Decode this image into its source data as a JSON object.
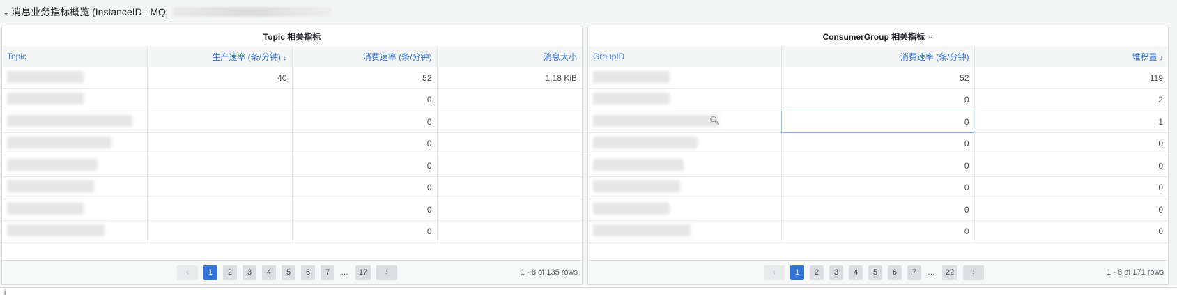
{
  "row": {
    "chevron": "⌄",
    "title": "消息业务指标概览 (InstanceID : MQ_"
  },
  "topic_panel": {
    "title": "Topic 相关指标",
    "columns": [
      "Topic",
      "生产速率 (条/分钟)",
      "消费速率 (条/分钟)",
      "消息大小"
    ],
    "sorted_column_icon": "sort-down-arrow",
    "rows": [
      [
        "",
        "40",
        "52",
        "1.18 KiB"
      ],
      [
        "",
        "",
        "0",
        ""
      ],
      [
        "",
        "",
        "0",
        ""
      ],
      [
        "",
        "",
        "0",
        ""
      ],
      [
        "",
        "",
        "0",
        ""
      ],
      [
        "",
        "",
        "0",
        ""
      ],
      [
        "",
        "",
        "0",
        ""
      ],
      [
        "",
        "",
        "0",
        ""
      ]
    ],
    "pages": [
      "1",
      "2",
      "3",
      "4",
      "5",
      "6",
      "7",
      "…",
      "17"
    ],
    "active_page": "1",
    "prev": "‹",
    "next": "›",
    "info": "1 - 8 of 135 rows"
  },
  "group_panel": {
    "title": "ConsumerGroup 相关指标",
    "title_dropdown": "⌄",
    "columns": [
      "GroupID",
      "消费速率 (条/分钟)",
      "堆积量"
    ],
    "sorted_column_icon": "sort-down-arrow",
    "rows": [
      [
        "",
        "52",
        "119"
      ],
      [
        "",
        "0",
        "2"
      ],
      [
        "",
        "0",
        "1"
      ],
      [
        "",
        "0",
        "0"
      ],
      [
        "",
        "0",
        "0"
      ],
      [
        "",
        "0",
        "0"
      ],
      [
        "",
        "0",
        "0"
      ],
      [
        "",
        "0",
        "0"
      ]
    ],
    "pages": [
      "1",
      "2",
      "3",
      "4",
      "5",
      "6",
      "7",
      "…",
      "22"
    ],
    "active_page": "1",
    "prev": "‹",
    "next": "›",
    "info": "1 - 8 of 171 rows"
  },
  "bottom_panel": {
    "info_icon": "i"
  },
  "colors": {
    "accent": "#3274d9",
    "header_bg": "#f4f5f5",
    "border": "#dcdee1"
  }
}
